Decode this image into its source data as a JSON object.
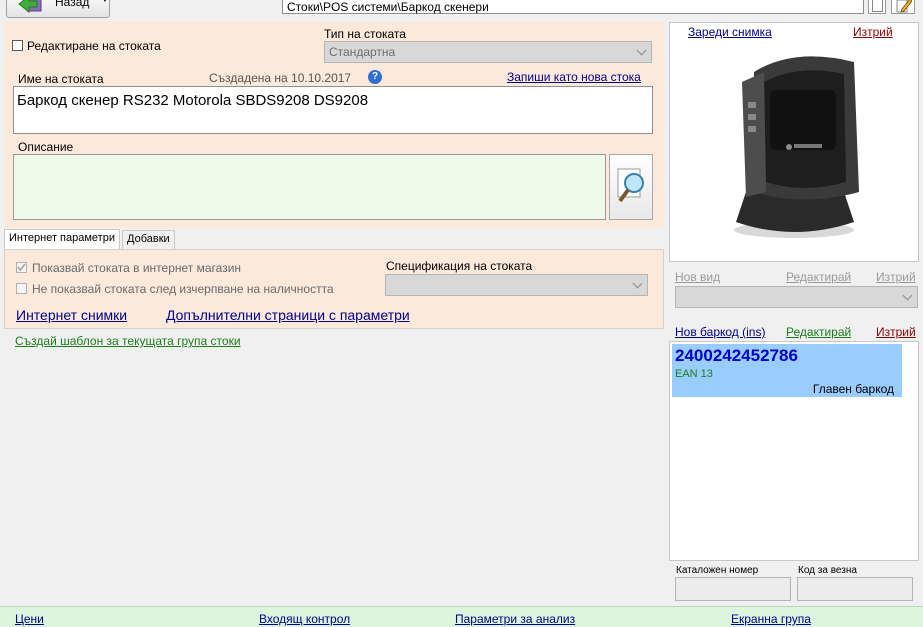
{
  "toolbar": {
    "back_label": "Назад"
  },
  "path": {
    "value": "Стоки\\POS системи\\Баркод скенери"
  },
  "edit_item": {
    "label": "Редактиране на стоката"
  },
  "item_type": {
    "label": "Тип на стоката",
    "value": "Стандартна"
  },
  "item_name": {
    "label": "Име на стоката",
    "created": "Създадена на 10.10.2017",
    "save_as_new": "Запиши като нова стока",
    "value": "Баркод скенер RS232 Motorola SBDS9208 DS9208"
  },
  "description": {
    "label": "Описание",
    "value": ""
  },
  "tabs": [
    {
      "label": "Интернет параметри"
    },
    {
      "label": "Добавки"
    }
  ],
  "internet": {
    "show_in_shop": "Показвай стоката в интернет магазин",
    "hide_when_out": "Не показвай стоката след изчерпване на наличността",
    "spec_label": "Спецификация на стоката",
    "spec_value": "",
    "photos_link": "Интернет снимки",
    "extra_pages_link": "Допълнителни страници с параметри"
  },
  "template_link": "Създай шаблон за текущата група стоки",
  "image_panel": {
    "load": "Зареди снимка",
    "delete": "Изтрий"
  },
  "view": {
    "new": "Нов вид",
    "edit": "Редактирай",
    "delete": "Изтрий",
    "value": ""
  },
  "barcode": {
    "new": "Нов баркод (ins)",
    "edit": "Редактирай",
    "delete": "Изтрий",
    "items": [
      {
        "code": "2400242452786",
        "type": "EAN 13",
        "note": "Главен баркод"
      }
    ]
  },
  "catalog": {
    "label": "Каталожен номер",
    "value": ""
  },
  "scale": {
    "label": "Код за везна",
    "value": ""
  },
  "bottom_tabs": [
    {
      "label": "Цени"
    },
    {
      "label": "Входящ контрол"
    },
    {
      "label": "Параметри за анализ"
    },
    {
      "label": "Екранна група"
    }
  ],
  "colors": {
    "peach": "#fbe9dc",
    "selected_barcode": "#99ccff",
    "barcode_text": "#0000cc",
    "bottom_bar": "#dcf5dc"
  }
}
